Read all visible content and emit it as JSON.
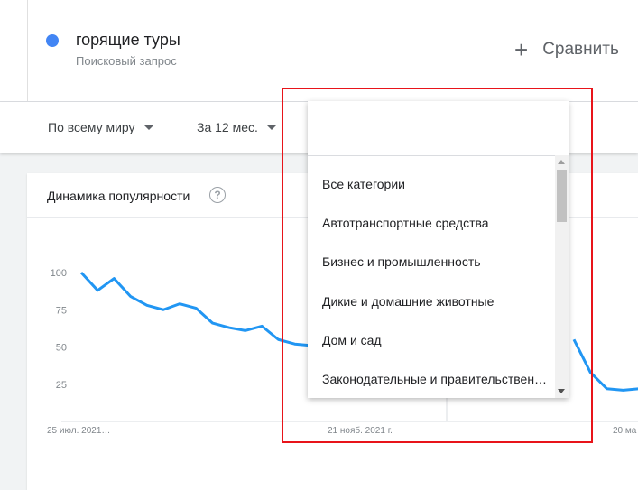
{
  "term": {
    "name": "горящие туры",
    "subtitle": "Поисковый запрос",
    "color": "#4285f4"
  },
  "compare": {
    "label": "Сравнить"
  },
  "filters": {
    "region": "По всему миру",
    "period": "За 12 мес."
  },
  "card": {
    "title": "Динамика популярности",
    "help_icon": "question-circle-icon"
  },
  "dropdown": {
    "items": [
      "Все категории",
      "Автотранспортные средства",
      "Бизнес и промышленность",
      "Дикие и домашние животные",
      "Дом и сад",
      "Законодательные и правительствен…"
    ]
  },
  "chart_data": {
    "type": "line",
    "color": "#2196f3",
    "y_ticks": [
      "100",
      "75",
      "50",
      "25"
    ],
    "x_ticks": [
      "25 июл. 2021…",
      "21 нояб. 2021 г.",
      "20 ма"
    ],
    "ylim": [
      0,
      100
    ],
    "grid": false,
    "series": [
      {
        "segment": "left",
        "x": [
          0,
          1,
          2,
          3,
          4,
          5,
          6,
          7,
          8,
          9,
          10,
          11,
          12,
          13,
          14,
          15,
          16
        ],
        "values": [
          100,
          88,
          96,
          84,
          78,
          75,
          79,
          76,
          66,
          63,
          61,
          64,
          55,
          52,
          51,
          50,
          50
        ]
      },
      {
        "segment": "right",
        "x": [
          30,
          31,
          32,
          33,
          34
        ],
        "values": [
          55,
          33,
          22,
          21,
          22
        ]
      }
    ]
  }
}
